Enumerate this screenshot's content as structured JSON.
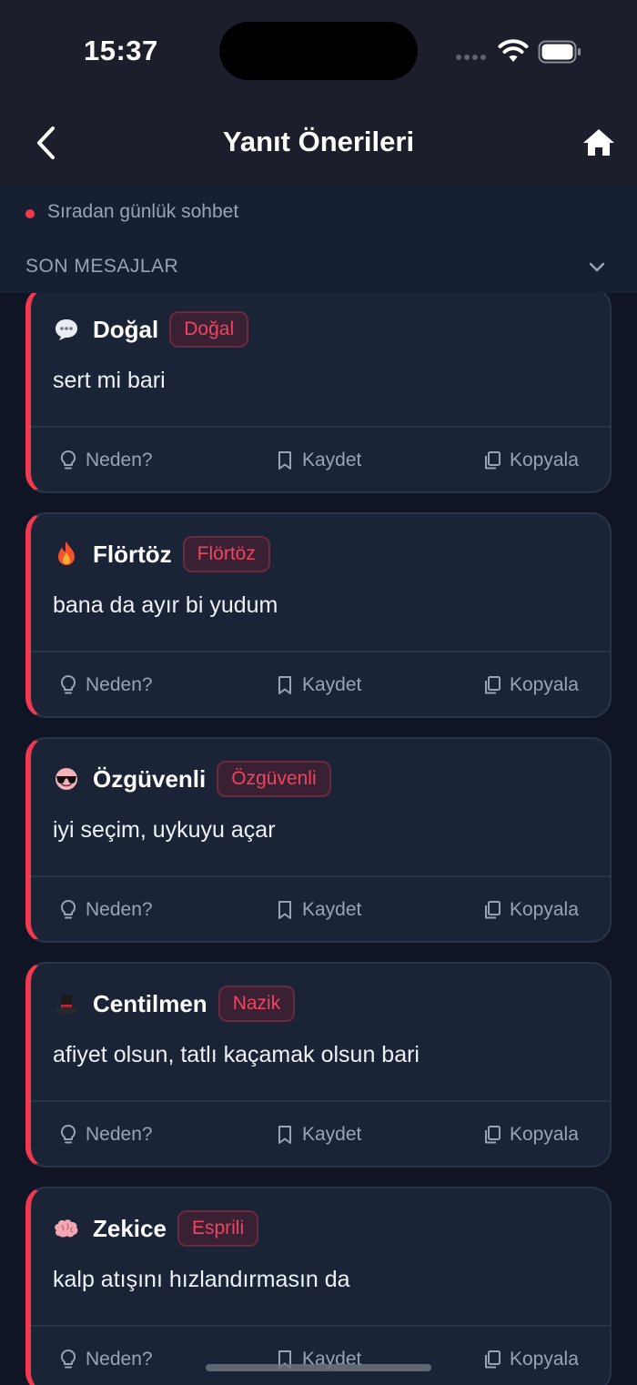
{
  "status_bar": {
    "time": "15:37"
  },
  "header": {
    "title": "Yanıt Önerileri"
  },
  "context": {
    "label": "Sıradan günlük sohbet"
  },
  "section": {
    "title": "SON MESAJLAR"
  },
  "actions": {
    "why": "Neden?",
    "save": "Kaydet",
    "copy": "Kopyala"
  },
  "colors": {
    "accent": "#f0384f",
    "card_bg": "#1b2437",
    "page_bg": "#0f1525",
    "header_bg": "#1c1f2b"
  },
  "cards": [
    {
      "emoji_icon": "speech-bubble-icon",
      "name": "Doğal",
      "tag": "Doğal",
      "text": "sert mi bari"
    },
    {
      "emoji_icon": "fire-icon",
      "name": "Flörtöz",
      "tag": "Flörtöz",
      "text": "bana da ayır bi yudum"
    },
    {
      "emoji_icon": "sunglasses-face-icon",
      "name": "Özgüvenli",
      "tag": "Özgüvenli",
      "text": "iyi seçim, uykuyu açar"
    },
    {
      "emoji_icon": "top-hat-icon",
      "name": "Centilmen",
      "tag": "Nazik",
      "text": "afiyet olsun, tatlı kaçamak olsun bari"
    },
    {
      "emoji_icon": "brain-icon",
      "name": "Zekice",
      "tag": "Esprili",
      "text": "kalp atışını hızlandırmasın da"
    }
  ]
}
